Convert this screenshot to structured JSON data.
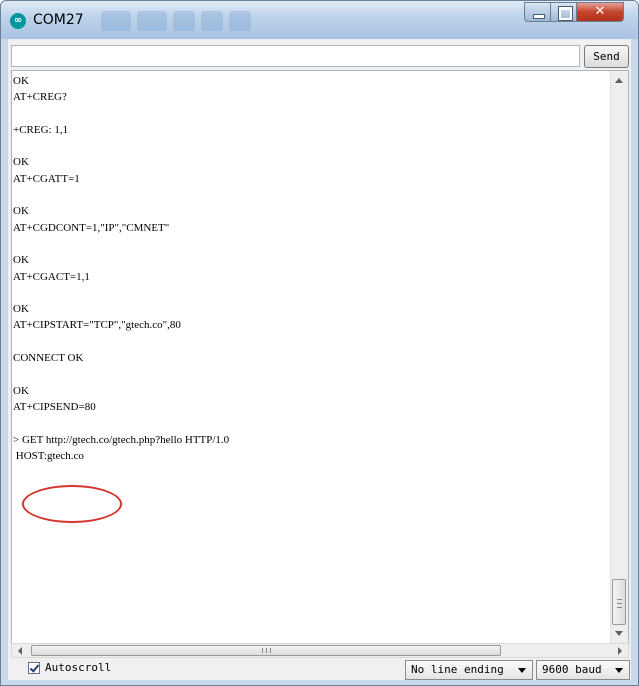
{
  "window": {
    "title": "COM27",
    "icon": "arduino-infinity-icon"
  },
  "toolbar": {
    "input_value": "",
    "send_label": "Send"
  },
  "output": {
    "lines": [
      "OK",
      "AT+CREG?",
      "",
      "+CREG: 1,1",
      "",
      "OK",
      "AT+CGATT=1",
      "",
      "OK",
      "AT+CGDCONT=1,\"IP\",\"CMNET\"",
      "",
      "OK",
      "AT+CGACT=1,1",
      "",
      "OK",
      "AT+CIPSTART=\"TCP\",\"gtech.co\",80",
      "",
      "CONNECT OK",
      "",
      "OK",
      "AT+CIPSEND=80",
      "",
      "> GET http://gtech.co/gtech.php?hello HTTP/1.0",
      " HOST:gtech.co"
    ],
    "highlight_color": "#d9342b"
  },
  "footer": {
    "autoscroll_label": "Autoscroll",
    "autoscroll_checked": true,
    "line_ending_value": "No line ending",
    "baud_value": "9600 baud"
  }
}
